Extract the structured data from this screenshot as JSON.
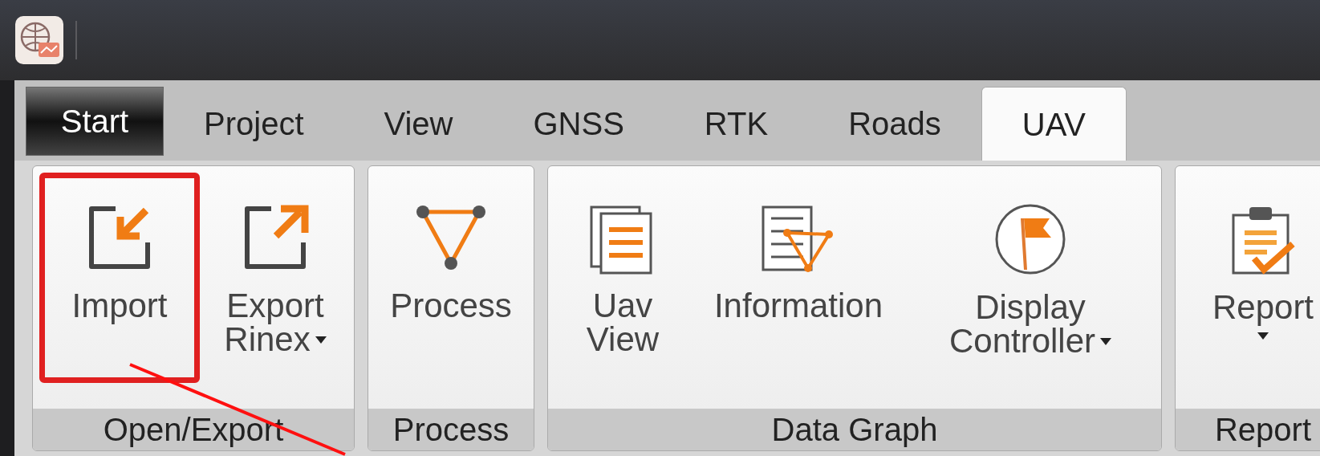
{
  "tabs": [
    {
      "label": "Start",
      "kind": "menu",
      "selected": false
    },
    {
      "label": "Project",
      "kind": "tab",
      "selected": false
    },
    {
      "label": "View",
      "kind": "tab",
      "selected": false
    },
    {
      "label": "GNSS",
      "kind": "tab",
      "selected": false
    },
    {
      "label": "RTK",
      "kind": "tab",
      "selected": false
    },
    {
      "label": "Roads",
      "kind": "tab",
      "selected": false
    },
    {
      "label": "UAV",
      "kind": "tab",
      "selected": true
    }
  ],
  "groups": [
    {
      "label": "Open/Export",
      "buttons": [
        {
          "lines": [
            "Import"
          ],
          "dropdown": false,
          "highlighted": true
        },
        {
          "lines": [
            "Export",
            "Rinex"
          ],
          "dropdown": true,
          "highlighted": false
        }
      ]
    },
    {
      "label": "Process",
      "buttons": [
        {
          "lines": [
            "Process"
          ],
          "dropdown": false,
          "highlighted": false
        }
      ]
    },
    {
      "label": "Data Graph",
      "buttons": [
        {
          "lines": [
            "Uav",
            "View"
          ],
          "dropdown": false,
          "highlighted": false
        },
        {
          "lines": [
            "Information"
          ],
          "dropdown": false,
          "highlighted": false
        },
        {
          "lines": [
            "Display",
            "Controller"
          ],
          "dropdown": true,
          "highlighted": false
        }
      ]
    },
    {
      "label": "Report",
      "buttons": [
        {
          "lines": [
            "Report"
          ],
          "dropdown": true,
          "highlighted": false
        }
      ]
    }
  ]
}
